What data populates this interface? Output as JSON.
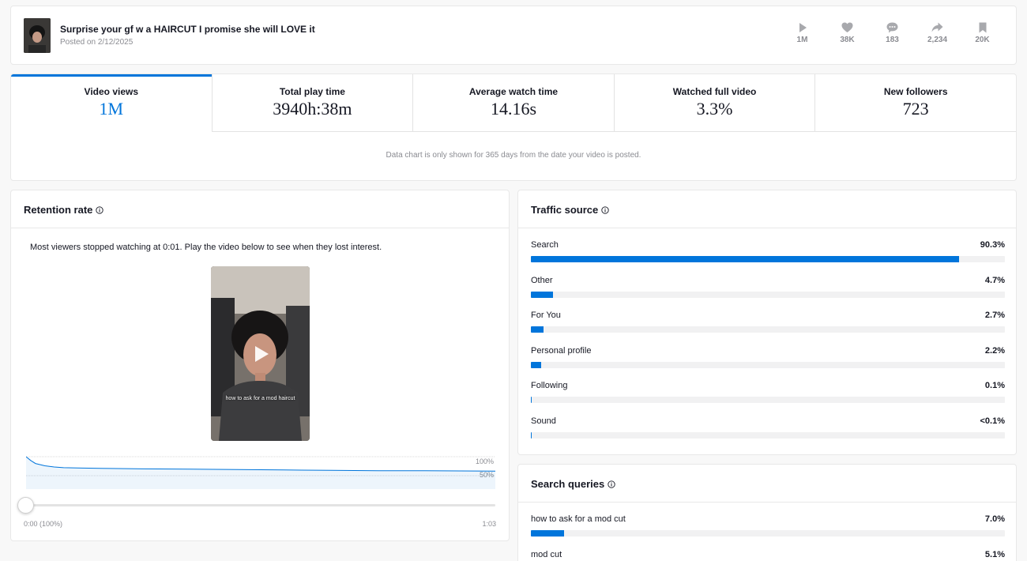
{
  "post": {
    "title": "Surprise your gf w a HAIRCUT I promise she will LOVE it",
    "date": "Posted on 2/12/2025",
    "stats": [
      {
        "icon": "play-icon",
        "value": "1M"
      },
      {
        "icon": "heart-icon",
        "value": "38K"
      },
      {
        "icon": "comment-icon",
        "value": "183"
      },
      {
        "icon": "share-icon",
        "value": "2,234"
      },
      {
        "icon": "bookmark-icon",
        "value": "20K"
      }
    ]
  },
  "metrics": [
    {
      "label": "Video views",
      "value": "1M"
    },
    {
      "label": "Total play time",
      "value": "3940h:38m"
    },
    {
      "label": "Average watch time",
      "value": "14.16s"
    },
    {
      "label": "Watched full video",
      "value": "3.3%"
    },
    {
      "label": "New followers",
      "value": "723"
    }
  ],
  "chart_note": "Data chart is only shown for 365 days from the date your video is posted.",
  "retention": {
    "title": "Retention rate",
    "description": "Most viewers stopped watching at 0:01. Play the video below to see when they lost interest.",
    "video_caption": "how to ask for a mod haircut",
    "label_100": "100%",
    "label_50": "50%",
    "start_label": "0:00 (100%)",
    "end_label": "1:03",
    "curve": [
      [
        0,
        100
      ],
      [
        1,
        90
      ],
      [
        2,
        82
      ],
      [
        4,
        76
      ],
      [
        6,
        73
      ],
      [
        8,
        71
      ],
      [
        12,
        70
      ],
      [
        18,
        69
      ],
      [
        25,
        68
      ],
      [
        35,
        67
      ],
      [
        45,
        66
      ],
      [
        55,
        65
      ],
      [
        65,
        64
      ],
      [
        75,
        63
      ],
      [
        85,
        63
      ],
      [
        100,
        62
      ]
    ],
    "accent": "#0075db"
  },
  "traffic": {
    "title": "Traffic source",
    "items": [
      {
        "label": "Search",
        "pct": "90.3%",
        "value": 90.3
      },
      {
        "label": "Other",
        "pct": "4.7%",
        "value": 4.7
      },
      {
        "label": "For You",
        "pct": "2.7%",
        "value": 2.7
      },
      {
        "label": "Personal profile",
        "pct": "2.2%",
        "value": 2.2
      },
      {
        "label": "Following",
        "pct": "0.1%",
        "value": 0.1
      },
      {
        "label": "Sound",
        "pct": "<0.1%",
        "value": 0.05
      }
    ]
  },
  "search_queries": {
    "title": "Search queries",
    "items": [
      {
        "label": "how to ask for a mod cut",
        "pct": "7.0%",
        "value": 7.0
      },
      {
        "label": "mod cut",
        "pct": "5.1%",
        "value": 5.1
      }
    ]
  },
  "colors": {
    "accent": "#0075db",
    "muted": "#8a8b91"
  }
}
